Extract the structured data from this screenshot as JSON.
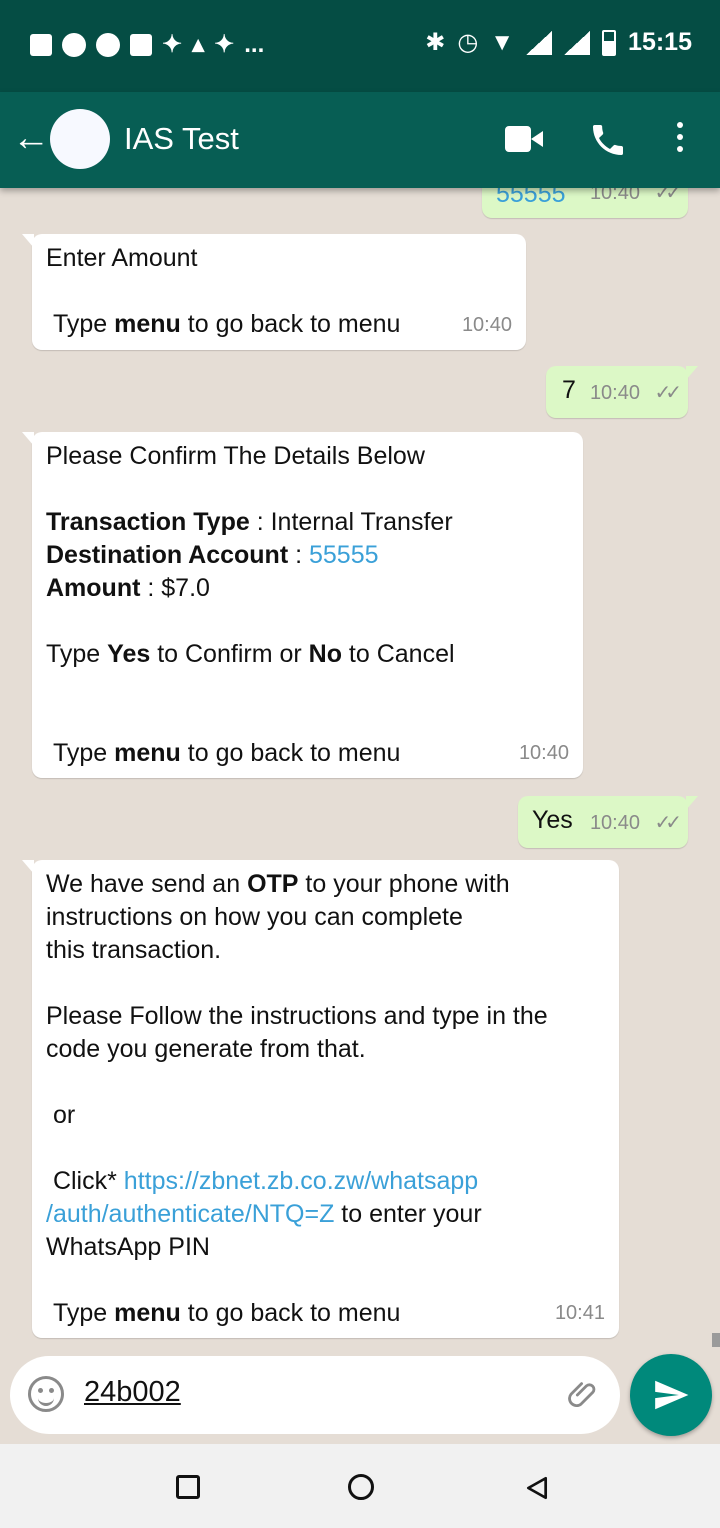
{
  "status_bar": {
    "left_icons": [
      "facebook-icon",
      "chrome-icon",
      "circle-icon",
      "gallery-icon",
      "twitter-icon",
      "wifi-calling-icon",
      "twitter-icon",
      "more-notifications-icon"
    ],
    "more_label": "...",
    "right_icons": [
      "bluetooth-icon",
      "alarm-icon",
      "wifi-icon",
      "signal-icon",
      "signal-icon",
      "battery-icon"
    ],
    "time": "15:15"
  },
  "header": {
    "title": "IAS Test",
    "actions": [
      "video-call-icon",
      "phone-call-icon",
      "more-options-icon"
    ]
  },
  "messages": {
    "m0": {
      "text": "55555",
      "time": "10:40"
    },
    "m1": {
      "line1": "Enter Amount",
      "footer_pre": "Type ",
      "footer_bold": "menu",
      "footer_post": " to go back to menu",
      "time": "10:40"
    },
    "m2": {
      "text": "7",
      "time": "10:40"
    },
    "m3": {
      "line1": "Please Confirm The Details Below",
      "type_label": "Transaction Type",
      "type_sep": " : ",
      "type_value": "Internal Transfer",
      "dest_label": "Destination Account",
      "dest_sep": " : ",
      "dest_value": "55555",
      "amount_label": "Amount",
      "amount_sep": " : ",
      "amount_value": "$7.0",
      "confirm_pre": "Type ",
      "confirm_yes": "Yes",
      "confirm_mid": " to Confirm or ",
      "confirm_no": "No",
      "confirm_post": " to Cancel",
      "footer_pre": "Type ",
      "footer_bold": "menu",
      "footer_post": " to go back to menu",
      "time": "10:40"
    },
    "m4": {
      "text": "Yes",
      "time": "10:40"
    },
    "m5": {
      "line1_pre": "We have send an ",
      "line1_bold": "OTP",
      "line1_post": " to your phone with",
      "line2": "instructions on how you can complete",
      "line3": "this transaction.",
      "para2_line1": "Please Follow the instructions and type in the",
      "para2_line2": "code you generate from that.",
      "or": " or",
      "click_pre": " Click* ",
      "link_line1": "https://zbnet.zb.co.zw/whatsapp",
      "link_line2": "/auth/authenticate/NTQ=Z",
      "click_post": " to enter your",
      "click_line3": "WhatsApp PIN",
      "footer_pre": "Type ",
      "footer_bold": "menu",
      "footer_post": " to go back to menu",
      "time": "10:41"
    }
  },
  "composer": {
    "value": "24b002",
    "emoji_icon": "emoji-icon",
    "attach_icon": "paperclip-icon",
    "send_icon": "send-icon"
  },
  "nav": [
    "recents-icon",
    "home-icon",
    "back-icon"
  ],
  "colors": {
    "status_bar": "#054d44",
    "app_bar": "#075e54",
    "outgoing": "#dcf8c6",
    "incoming": "#ffffff",
    "link": "#3aa0d8",
    "send_button": "#00897b"
  }
}
